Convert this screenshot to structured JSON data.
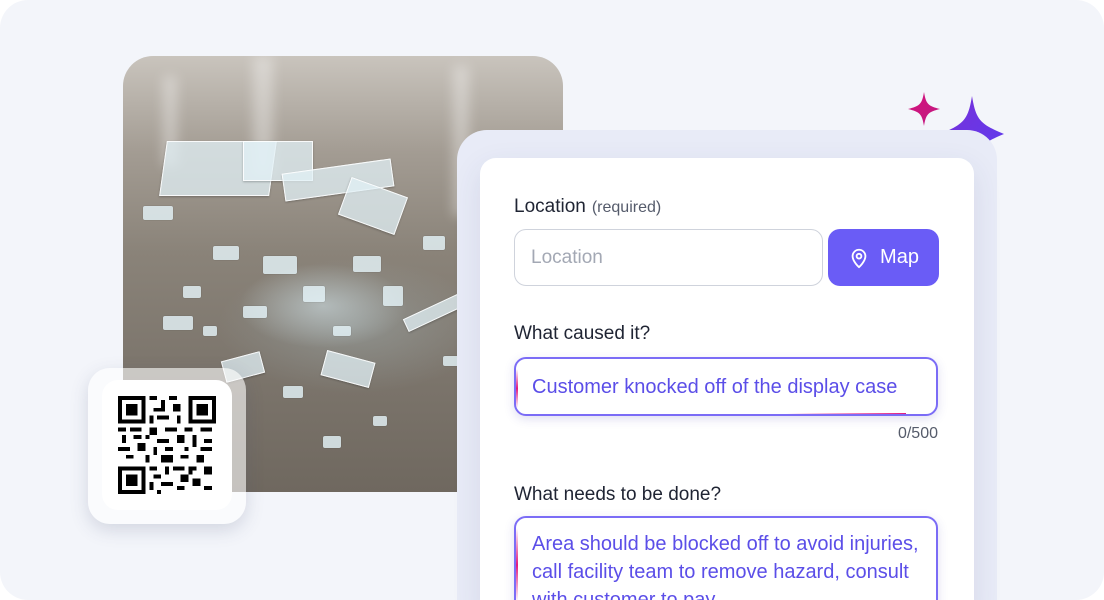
{
  "form": {
    "location": {
      "label": "Location",
      "required_hint": "(required)",
      "placeholder": "Location",
      "map_button_label": "Map"
    },
    "cause": {
      "label": "What caused it?",
      "value": "Customer knocked off of the display case",
      "counter": "0/500"
    },
    "action": {
      "label": "What needs to be done?",
      "value": "Area should be blocked off to avoid injuries, call facility team to remove hazard, consult with customer to pay"
    }
  },
  "colors": {
    "accent": "#6a5cf6",
    "ai_text": "#5b4ee8",
    "ai_highlight": "#e21b7d",
    "background": "#f3f5fa"
  },
  "icons": {
    "map": "map-pin-icon",
    "sparkles": "ai-sparkles-icon",
    "qr": "qr-code-icon"
  }
}
